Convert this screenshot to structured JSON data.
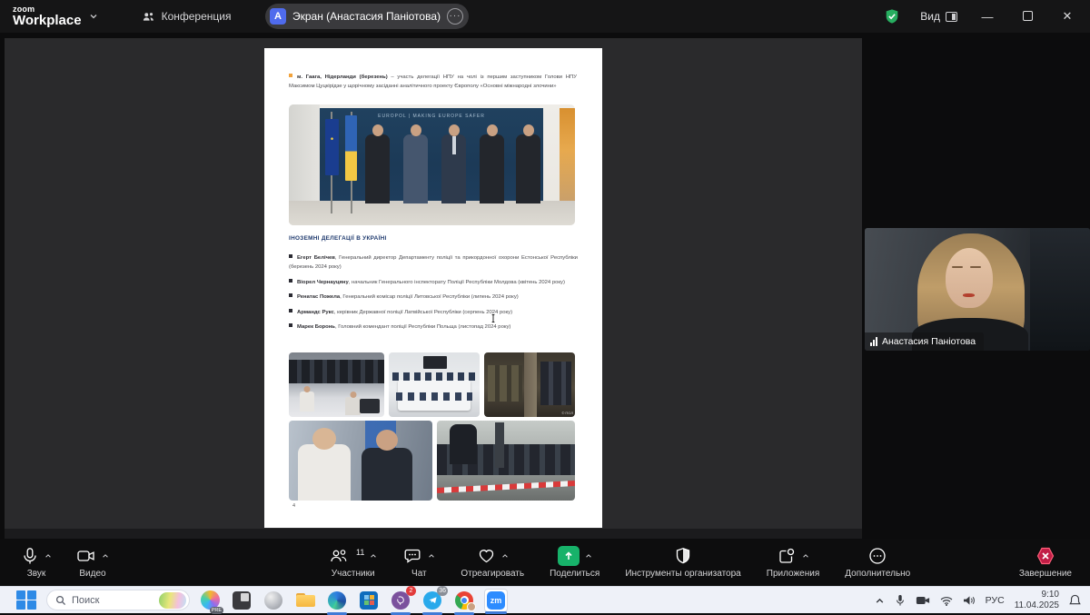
{
  "window": {
    "logo_line1": "zoom",
    "logo_line2": "Workplace",
    "meeting_label": "Конференция",
    "screen_tab_label": "Экран (Анастасия Паніотова)",
    "screen_tab_avatar": "А",
    "screen_tab_more": "···",
    "view_label": "Вид"
  },
  "document": {
    "intro_lead": "м. Гаага, Нідерланди (березень)",
    "intro_rest": " – участь делегації НПУ на чолі із першим заступником Голови НПУ Максимом Цуцкірідзе у щорічному засіданні аналітичного проекту Європолу «Основні міжнародні злочини»",
    "europol_banner": "EUROPOL   |   MAKING EUROPE SAFER",
    "heading": "ІНОЗЕМНІ ДЕЛЕГАЦІЇ В УКРАЇНІ",
    "delegations": [
      {
        "name": "Егерт Белічев",
        "desc": ", Генеральний директор Департаменту поліції та прикордонної охорони Естонської Республіки (березень 2024 року)"
      },
      {
        "name": "Віорел Чернауцяну",
        "desc": ", начальник Генерального інспекторату Поліції Республіки Молдова (квітень 2024 року)"
      },
      {
        "name": "Ренатас Пожела",
        "desc": ", Генеральний комісар поліції Литовської Республіки (липень 2024 року)"
      },
      {
        "name": "Армандс Рукс",
        "desc": ", керівник Державної поліції Латвійської Республіки (серпень 2024 року)"
      },
      {
        "name": "Марек Боронь",
        "desc": ", Головний комендант поліції Республіки Польща (листопад 2024 року)"
      }
    ],
    "page_number": "4"
  },
  "video_tile": {
    "participant_name": "Анастасия Паніотова"
  },
  "toolbar": {
    "audio_label": "Звук",
    "video_label": "Видео",
    "participants_label": "Участники",
    "participants_count": "11",
    "chat_label": "Чат",
    "react_label": "Отреагировать",
    "share_label": "Поделиться",
    "host_tools_label": "Инструменты организатора",
    "apps_label": "Приложения",
    "more_label": "Дополнительно",
    "end_label": "Завершение"
  },
  "taskbar": {
    "search_label": "Поиск",
    "copilot_badge": "PRE",
    "viber_badge": "2",
    "telegram_badge": "36",
    "zoom_app_label": "zm",
    "language": "РУС",
    "time": "9:10",
    "date": "11.04.2025"
  },
  "colors": {
    "zoom_green": "#17b26a",
    "end_red": "#c11d46",
    "accent_blue": "#2d8cff",
    "doc_heading_navy": "#1f3a6e",
    "doc_bullet_orange": "#f2a33c"
  }
}
